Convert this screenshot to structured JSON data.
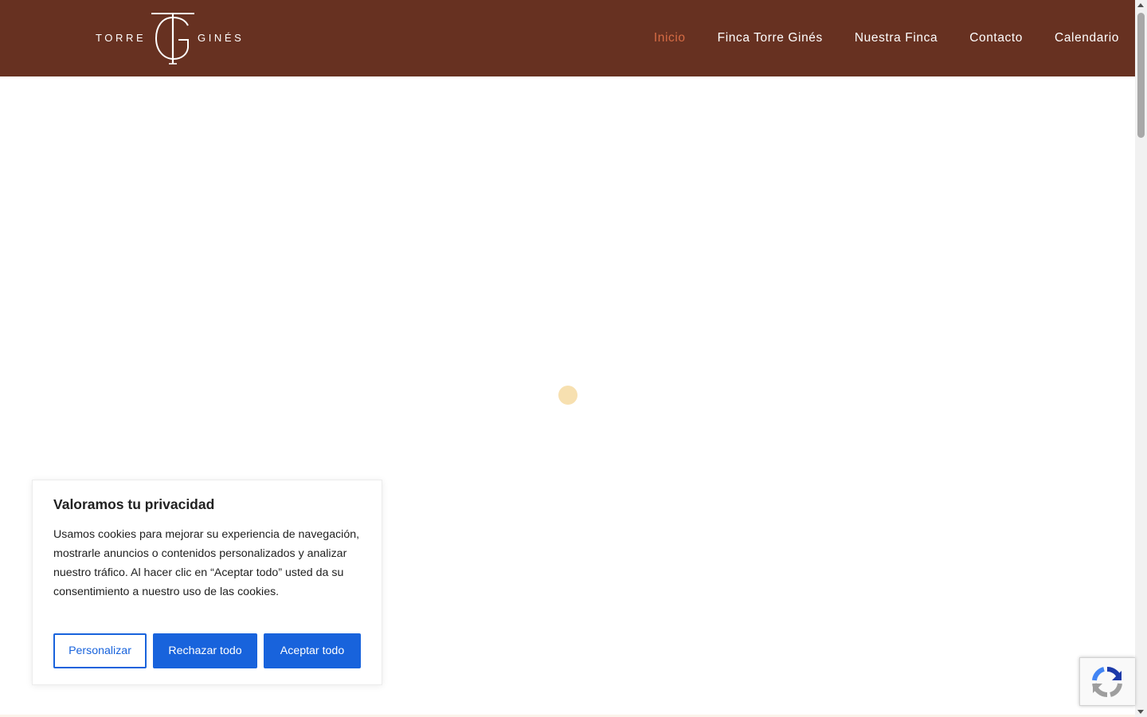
{
  "header": {
    "logo": {
      "left_word": "TORRE",
      "right_word": "GINÉS"
    },
    "nav": [
      {
        "label": "Inicio",
        "active": true
      },
      {
        "label": "Finca Torre Ginés",
        "active": false
      },
      {
        "label": "Nuestra Finca",
        "active": false
      },
      {
        "label": "Contacto",
        "active": false
      },
      {
        "label": "Calendario",
        "active": false
      }
    ]
  },
  "cookie_banner": {
    "title": "Valoramos tu privacidad",
    "text": "Usamos cookies para mejorar su experiencia de navegación, mostrarle anuncios o contenidos personalizados y analizar nuestro tráfico. Al hacer clic en “Aceptar todo” usted da su consentimiento a nuestro uso de las cookies.",
    "buttons": {
      "customize": "Personalizar",
      "reject": "Rechazar todo",
      "accept": "Aceptar todo"
    }
  },
  "icons": {
    "loader": "loading-dot-icon",
    "recaptcha": "recaptcha-icon",
    "logo_mark": "tg-monogram-icon"
  },
  "colors": {
    "header_bg": "#673121",
    "nav_active": "#d56b44",
    "nav_text": "#ffffff",
    "button_primary": "#1863dc",
    "loader_dot": "#f7e0b0"
  }
}
